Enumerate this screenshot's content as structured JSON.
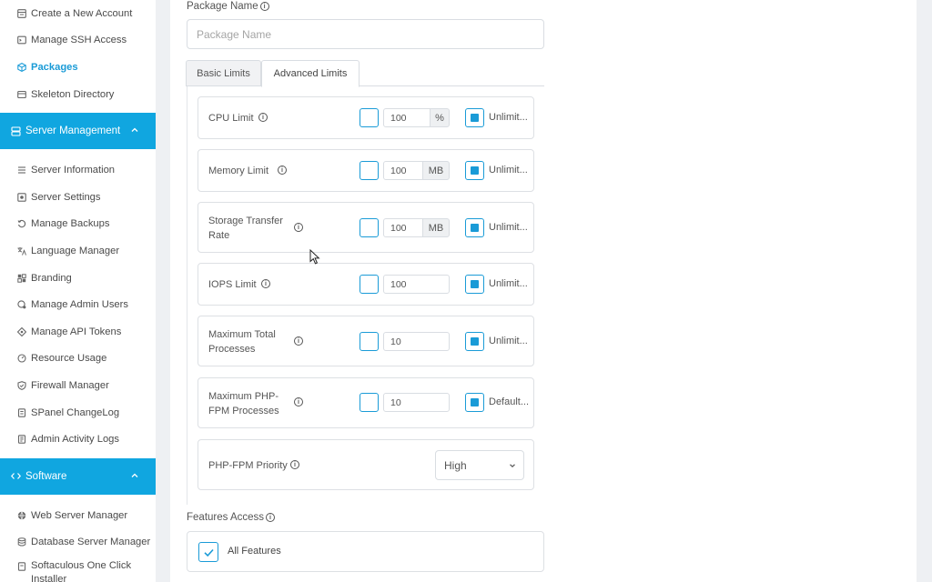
{
  "sidebar": {
    "items_top": [
      {
        "label": "Create a New Account",
        "icon": "create-account-icon"
      },
      {
        "label": "Manage SSH Access",
        "icon": "terminal-icon"
      },
      {
        "label": "Packages",
        "icon": "package-icon",
        "active": true
      },
      {
        "label": "Skeleton Directory",
        "icon": "folder-icon"
      }
    ],
    "section_server": {
      "label": "Server Management",
      "icon": "server-icon"
    },
    "items_server": [
      {
        "label": "Server Information",
        "icon": "list-icon"
      },
      {
        "label": "Server Settings",
        "icon": "settings-icon"
      },
      {
        "label": "Manage Backups",
        "icon": "backup-icon"
      },
      {
        "label": "Language Manager",
        "icon": "translate-icon"
      },
      {
        "label": "Branding",
        "icon": "branding-icon"
      },
      {
        "label": "Manage Admin Users",
        "icon": "user-shield-icon"
      },
      {
        "label": "Manage API Tokens",
        "icon": "api-icon"
      },
      {
        "label": "Resource Usage",
        "icon": "gauge-icon"
      },
      {
        "label": "Firewall Manager",
        "icon": "shield-icon"
      },
      {
        "label": "SPanel ChangeLog",
        "icon": "changelog-icon"
      },
      {
        "label": "Admin Activity Logs",
        "icon": "log-icon"
      }
    ],
    "section_software": {
      "label": "Software",
      "icon": "code-icon"
    },
    "items_software": [
      {
        "label": "Web Server Manager",
        "icon": "globe-icon"
      },
      {
        "label": "Database Server Manager",
        "icon": "database-icon"
      },
      {
        "label": "Softaculous One Click Installer",
        "icon": "installer-icon"
      }
    ]
  },
  "form": {
    "package_name_label": "Package Name",
    "package_name_placeholder": "Package Name",
    "tabs": [
      "Basic Limits",
      "Advanced Limits"
    ],
    "active_tab": "Advanced Limits",
    "limits": [
      {
        "name": "CPU Limit",
        "value": "100",
        "unit": "%",
        "unlimited_label": "Unlimit..."
      },
      {
        "name": "Memory Limit",
        "value": "100",
        "unit": "MB",
        "unlimited_label": "Unlimit..."
      },
      {
        "name": "Storage Transfer Rate",
        "value": "100",
        "unit": "MB",
        "unlimited_label": "Unlimit..."
      },
      {
        "name": "IOPS Limit",
        "value": "100",
        "unit": "",
        "unlimited_label": "Unlimit..."
      },
      {
        "name": "Maximum Total Processes",
        "value": "10",
        "unit": "",
        "unlimited_label": "Unlimit..."
      },
      {
        "name": "Maximum PHP-FPM Processes",
        "value": "10",
        "unit": "",
        "unlimited_label": "Default..."
      }
    ],
    "priority": {
      "name": "PHP-FPM Priority",
      "selected": "High"
    },
    "features_label": "Features Access",
    "features_all": "All Features"
  },
  "colors": {
    "accent": "#1a9bd7",
    "section_bg": "#10a6e0"
  }
}
